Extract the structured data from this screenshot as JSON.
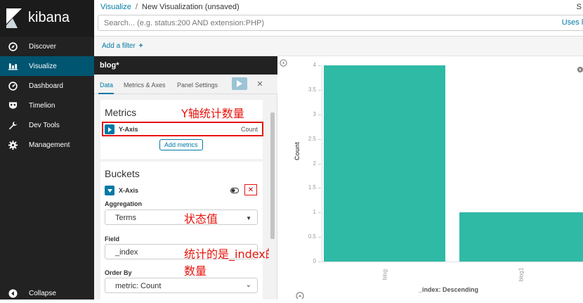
{
  "sidebar": {
    "brand": "kibana",
    "items": [
      {
        "label": "Discover",
        "icon": "compass-icon"
      },
      {
        "label": "Visualize",
        "icon": "bar-chart-icon",
        "active": true
      },
      {
        "label": "Dashboard",
        "icon": "dashboard-gauge-icon"
      },
      {
        "label": "Timelion",
        "icon": "timelion-mask-icon"
      },
      {
        "label": "Dev Tools",
        "icon": "wrench-icon"
      },
      {
        "label": "Management",
        "icon": "gear-icon"
      }
    ],
    "collapse": "Collapse"
  },
  "header": {
    "breadcrumb_root": "Visualize",
    "breadcrumb_separator": "/",
    "breadcrumb_current": "New Visualization (unsaved)",
    "top_right_fragment": "S",
    "search_placeholder": "Search... (e.g. status:200 AND extension:PHP)",
    "search_hint": "Uses luce",
    "add_filter": "Add a filter"
  },
  "editor": {
    "title": "blog*",
    "tabs": [
      "Data",
      "Metrics & Axes",
      "Panel Settings"
    ],
    "active_tab": "Data",
    "metrics": {
      "title": "Metrics",
      "agg_name": "Y-Axis",
      "agg_type": "Count",
      "add_button": "Add metrics"
    },
    "buckets": {
      "title": "Buckets",
      "agg_name": "X-Axis",
      "aggregation_label": "Aggregation",
      "aggregation_value": "Terms",
      "field_label": "Field",
      "field_value": "_index",
      "order_by_label": "Order By",
      "order_by_value": "metric: Count"
    }
  },
  "annotations": {
    "metrics_note": "Y轴统计数量",
    "aggregation_note": "状态值",
    "field_note": "统计的是_index的数量"
  },
  "colors": {
    "sidebar_bg": "#222222",
    "active_nav": "#005571",
    "link": "#0079a5",
    "bar": "#2fbaa6",
    "annotation": "#e8140c"
  },
  "chart_data": {
    "type": "bar",
    "categories": [
      "blog",
      "blog1"
    ],
    "values": [
      4,
      1
    ],
    "ylabel": "Count",
    "xlabel": "_index: Descending",
    "ylim": [
      0,
      4
    ],
    "yticks": [
      "0",
      "0.5",
      "1",
      "1.5",
      "2",
      "2.5",
      "3",
      "3.5",
      "4"
    ],
    "grid": false
  }
}
